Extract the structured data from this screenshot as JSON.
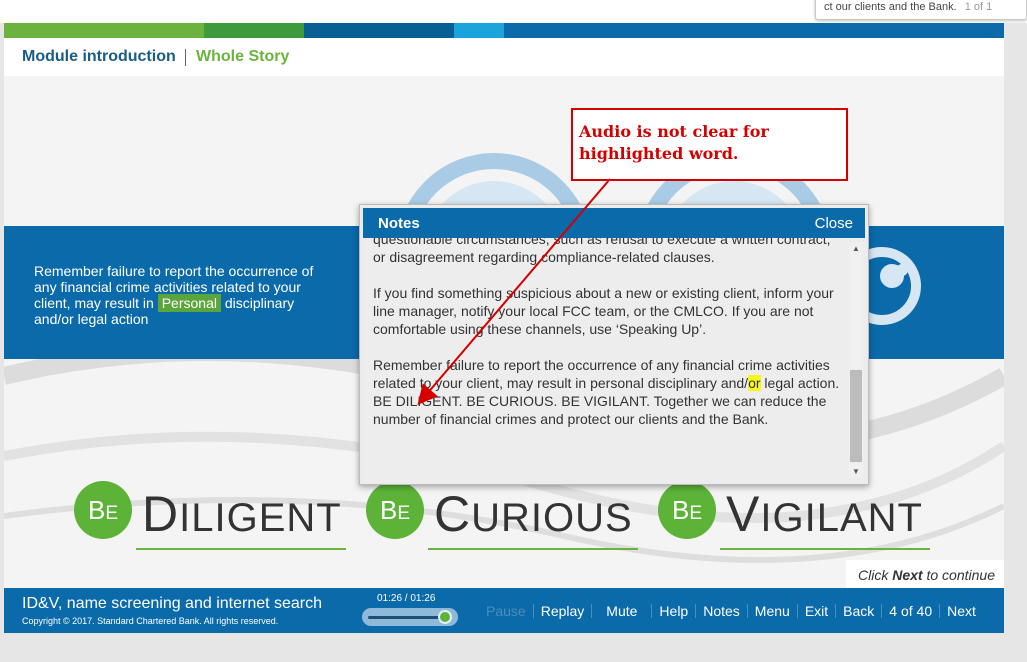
{
  "tooltip": {
    "text": "ct our clients and the Bank.",
    "count": "1 of 1"
  },
  "colors": {
    "green_light": "#6cb33e",
    "green_dark": "#3f9a3b",
    "blue_dark": "#075f94",
    "blue_light": "#1ba3dc",
    "panel_blue": "#0a6aaa",
    "annotation_red": "#d40000"
  },
  "nav": {
    "module_intro": "Module introduction",
    "whole_story": "Whole Story"
  },
  "left_panel": {
    "text_before": "Remember failure to report the occurrence of any financial crime activities related to your client, may result in",
    "highlight": "Personal",
    "text_after": "disciplinary and/or legal action"
  },
  "be_words": [
    {
      "be": "B",
      "e": "E",
      "first": "D",
      "rest": "ILIGENT"
    },
    {
      "be": "B",
      "e": "E",
      "first": "C",
      "rest": "URIOUS"
    },
    {
      "be": "B",
      "e": "E",
      "first": "V",
      "rest": "IGILANT"
    }
  ],
  "click_next": {
    "pre": "Click ",
    "bold": "Next",
    "post": " to continue"
  },
  "footer": {
    "course_title": "ID&V, name screening and internet search",
    "copyright": "Copyright © 2017. Standard Chartered Bank. All rights reserved.",
    "timecode": "01:26 / 01:26",
    "progress": 1.0,
    "buttons": {
      "pause": "Pause",
      "replay": "Replay",
      "mute": "Mute",
      "help": "Help",
      "notes": "Notes",
      "menu": "Menu",
      "exit": "Exit",
      "back": "Back",
      "page": "4 of 40",
      "next": "Next"
    }
  },
  "notes": {
    "title": "Notes",
    "close": "Close",
    "para0": "questionable circumstances, such as refusal to execute a written contract, or disagreement regarding compliance-related clauses.",
    "para1": "If you find something suspicious about a new or existing client, inform your line manager, notify your local FCC team, or the CMLCO. If you are not comfortable using these channels, use ‘Speaking Up’.",
    "para2_before": "Remember failure to report the occurrence of any financial crime activities related to your client, may result in personal disciplinary and/",
    "para2_highlight": "or",
    "para2_after": " legal action.",
    "para3": "BE DILIGENT. BE CURIOUS. BE VIGILANT. Together we can reduce the number of financial crimes and protect our clients and the Bank."
  },
  "annotation": {
    "text": "Audio is not clear for highlighted word."
  }
}
